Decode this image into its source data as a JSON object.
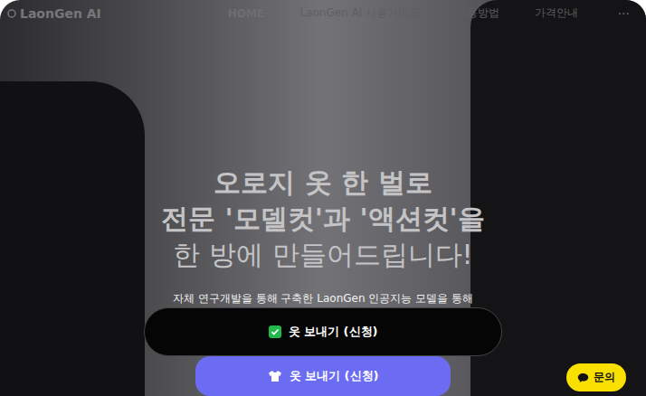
{
  "nav": {
    "logo": "LaonGen AI",
    "items": [
      {
        "label": "HOME",
        "selected": true
      },
      {
        "label": "LaonGen AI 사용가이드",
        "selected": false
      },
      {
        "label": "이용방법",
        "selected": false
      },
      {
        "label": "가격안내",
        "selected": false
      }
    ],
    "more": "···"
  },
  "hero": {
    "headline": [
      "오로지 옷 한 벌로",
      "전문 '모델컷'과 '액션컷'을",
      "한 방에 만들어드립니다!"
    ],
    "subtitle": "자체 연구개발을 통해 구축한 LaonGen 인공지능 모델을 통해"
  },
  "buttons": [
    {
      "label": "옷 보내기 (신청)",
      "kind": "primary"
    },
    {
      "label": "옷 보내기 (신청)",
      "kind": "secondary"
    }
  ],
  "chat": {
    "label": "문의"
  }
}
